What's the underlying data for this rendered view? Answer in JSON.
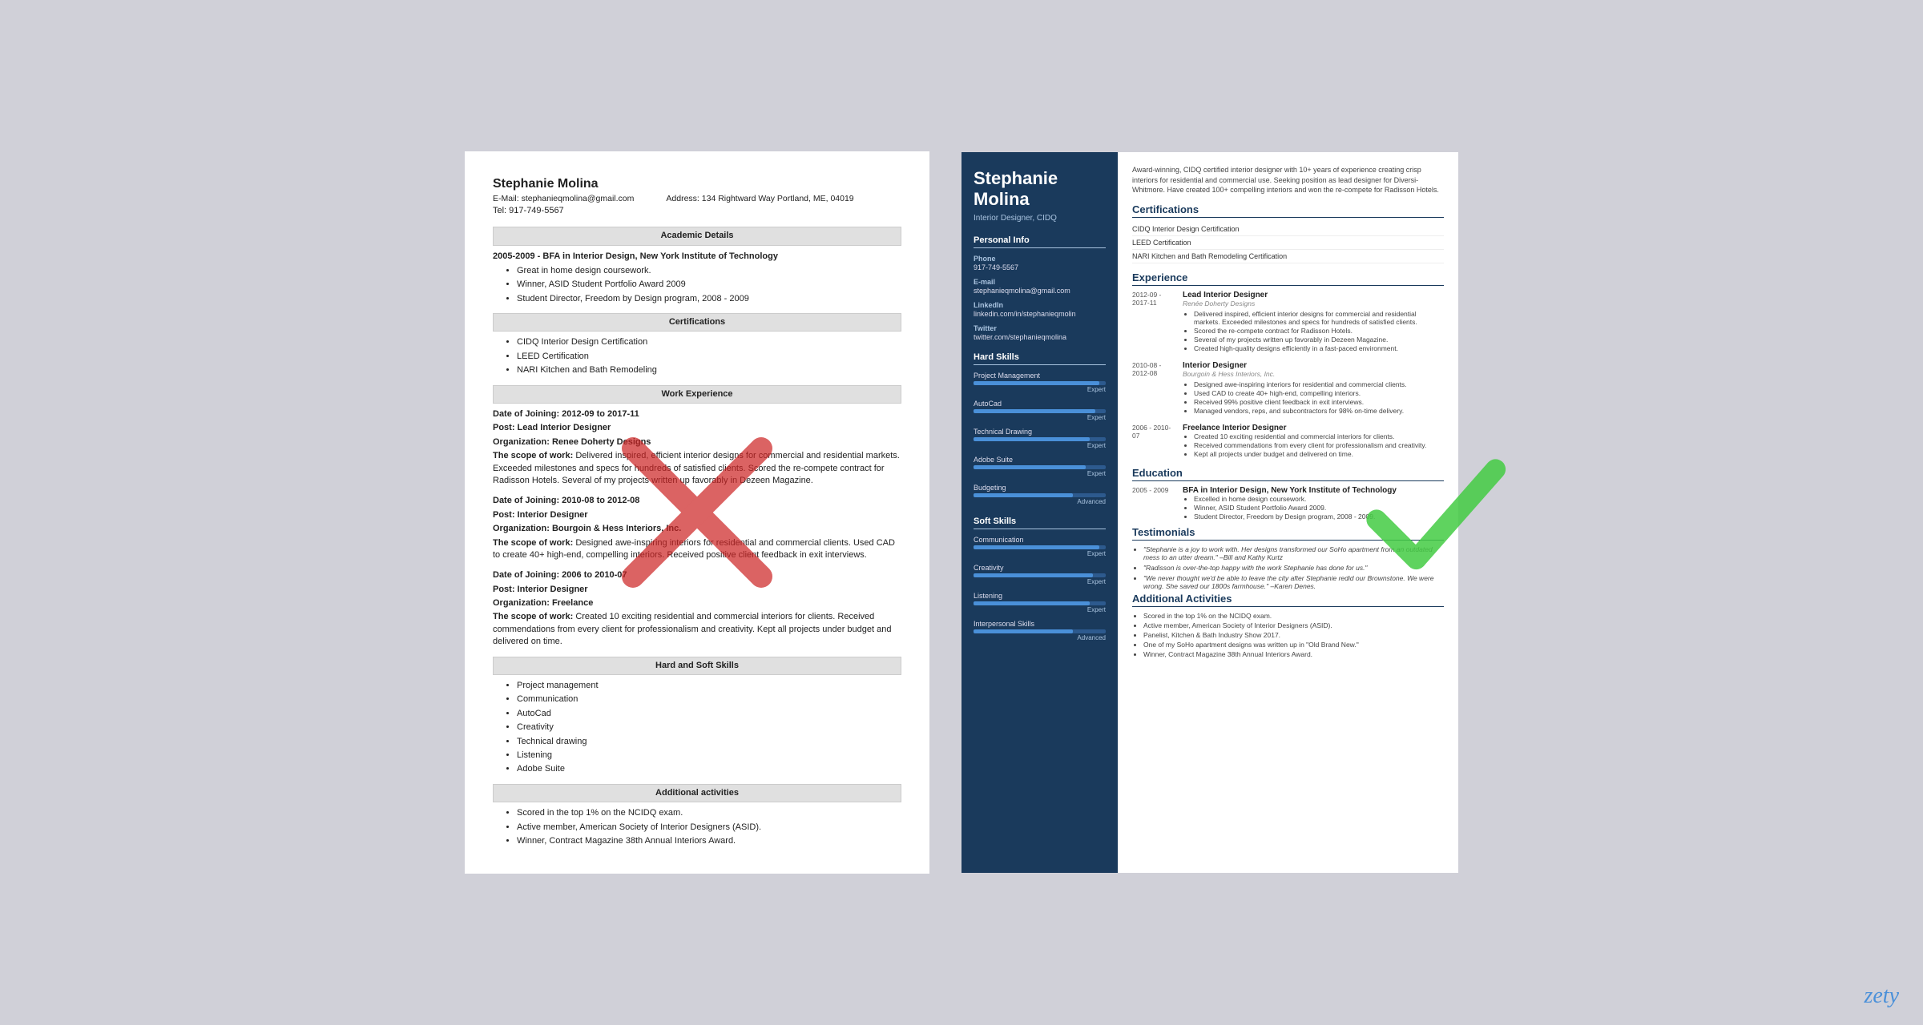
{
  "left_resume": {
    "name": "Stephanie Molina",
    "email_label": "E-Mail: stephanieqmolina@gmail.com",
    "address_label": "Address: 134 Rightward Way Portland, ME, 04019",
    "phone_label": "Tel: 917-749-5567",
    "sections": {
      "academic": {
        "header": "Academic Details",
        "entry": "2005-2009 - BFA in Interior Design, New York Institute of Technology",
        "bullets": [
          "Great in home design coursework.",
          "Winner, ASID Student Portfolio Award 2009",
          "Student Director, Freedom by Design program, 2008 - 2009"
        ]
      },
      "certifications": {
        "header": "Certifications",
        "items": [
          "CIDQ Interior Design Certification",
          "LEED Certification",
          "NARI Kitchen and Bath Remodeling"
        ]
      },
      "experience": {
        "header": "Work Experience",
        "jobs": [
          {
            "dates": "Date of Joining: 2012-09 to 2017-11",
            "post": "Post: Lead Interior Designer",
            "org": "Organization: Renee Doherty Designs",
            "scope_label": "The scope of work:",
            "scope": "Delivered inspired, efficient interior designs for commercial and residential markets. Exceeded milestones and specs for hundreds of satisfied clients. Scored the re-compete contract for Radisson Hotels. Several of my projects written up favorably in Dezeen Magazine."
          },
          {
            "dates": "Date of Joining: 2010-08 to 2012-08",
            "post": "Post: Interior Designer",
            "org": "Organization: Bourgoin & Hess Interiors, Inc.",
            "scope_label": "The scope of work:",
            "scope": "Designed awe-inspiring interiors for residential and commercial clients. Used CAD to create 40+ high-end, compelling interiors. Received positive client feedback in exit interviews."
          },
          {
            "dates": "Date of Joining: 2006 to 2010-07",
            "post": "Post: Interior Designer",
            "org": "Organization: Freelance",
            "scope_label": "The scope of work:",
            "scope": "Created 10 exciting residential and commercial interiors for clients. Received commendations from every client for professionalism and creativity. Kept all projects under budget and delivered on time."
          }
        ]
      },
      "skills": {
        "header": "Hard and Soft Skills",
        "items": [
          "Project management",
          "Communication",
          "AutoCad",
          "Creativity",
          "Technical drawing",
          "Listening",
          "Adobe Suite"
        ]
      },
      "activities": {
        "header": "Additional activities",
        "items": [
          "Scored in the top 1% on the NCIDQ exam.",
          "Active member, American Society of Interior Designers (ASID).",
          "Winner, Contract Magazine 38th Annual Interiors Award."
        ]
      }
    }
  },
  "right_resume": {
    "name": "Stephanie Molina",
    "title": "Interior Designer, CIDQ",
    "summary": "Award-winning, CIDQ certified interior designer with 10+ years of experience creating crisp interiors for residential and commercial use. Seeking position as lead designer for Diversi-Whitmore. Have created 100+ compelling interiors and won the re-compete for Radisson Hotels.",
    "sidebar": {
      "personal_info_label": "Personal Info",
      "phone_label": "Phone",
      "phone": "917-749-5567",
      "email_label": "E-mail",
      "email": "stephanieqmolina@gmail.com",
      "linkedin_label": "LinkedIn",
      "linkedin": "linkedin.com/in/stephanieqmolin",
      "twitter_label": "Twitter",
      "twitter": "twitter.com/stephanieqmolina",
      "hard_skills_label": "Hard Skills",
      "hard_skills": [
        {
          "name": "Project Management",
          "level": "Expert",
          "pct": 95
        },
        {
          "name": "AutoCad",
          "level": "Expert",
          "pct": 92
        },
        {
          "name": "Technical Drawing",
          "level": "Expert",
          "pct": 88
        },
        {
          "name": "Adobe Suite",
          "level": "Expert",
          "pct": 85
        },
        {
          "name": "Budgeting",
          "level": "Advanced",
          "pct": 75
        }
      ],
      "soft_skills_label": "Soft Skills",
      "soft_skills": [
        {
          "name": "Communication",
          "level": "Expert",
          "pct": 95
        },
        {
          "name": "Creativity",
          "level": "Expert",
          "pct": 90
        },
        {
          "name": "Listening",
          "level": "Expert",
          "pct": 88
        },
        {
          "name": "Interpersonal Skills",
          "level": "Advanced",
          "pct": 75
        }
      ]
    },
    "certifications_label": "Certifications",
    "certifications": [
      "CIDQ Interior Design Certification",
      "LEED Certification",
      "NARI Kitchen and Bath Remodeling Certification"
    ],
    "experience_label": "Experience",
    "experience": [
      {
        "dates": "2012-09 - 2017-11",
        "title": "Lead Interior Designer",
        "company": "Renée Doherty Designs",
        "bullets": [
          "Delivered inspired, efficient interior designs for commercial and residential markets. Exceeded milestones and specs for hundreds of satisfied clients.",
          "Scored the re-compete contract for Radisson Hotels.",
          "Several of my projects written up favorably in Dezeen Magazine.",
          "Created high-quality designs efficiently in a fast-paced environment."
        ]
      },
      {
        "dates": "2010-08 - 2012-08",
        "title": "Interior Designer",
        "company": "Bourgoin & Hess Interiors, Inc.",
        "bullets": [
          "Designed awe-inspiring interiors for residential and commercial clients.",
          "Used CAD to create 40+ high-end, compelling interiors.",
          "Received 99% positive client feedback in exit interviews.",
          "Managed vendors, reps, and subcontractors for 98% on-time delivery."
        ]
      },
      {
        "dates": "2006 - 2010-07",
        "title": "Freelance Interior Designer",
        "company": "",
        "bullets": [
          "Created 10 exciting residential and commercial interiors for clients.",
          "Received commendations from every client for professionalism and creativity.",
          "Kept all projects under budget and delivered on time."
        ]
      }
    ],
    "education_label": "Education",
    "education": [
      {
        "dates": "2005 - 2009",
        "degree": "BFA in Interior Design, New York Institute of Technology",
        "bullets": [
          "Excelled in home design coursework.",
          "Winner, ASID Student Portfolio Award 2009.",
          "Student Director, Freedom by Design program, 2008 - 2009."
        ]
      }
    ],
    "testimonials_label": "Testimonials",
    "testimonials": [
      "\"Stephanie is a joy to work with. Her designs transformed our SoHo apartment from an outdated mess to an utter dream.\" –Bill and Kathy Kurtz",
      "\"Radisson is over-the-top happy with the work Stephanie has done for us.\"",
      "\"We never thought we'd be able to leave the city after Stephanie redid our Brownstone. We were wrong. She saved our 1800s farmhouse.\" –Karen Denes."
    ],
    "activities_label": "Additional Activities",
    "activities": [
      "Scored in the top 1% on the NCIDQ exam.",
      "Active member, American Society of Interior Designers (ASID).",
      "Panelist, Kitchen & Bath Industry Show 2017.",
      "One of my SoHo apartment designs was written up in \"Old Brand New.\"",
      "Winner, Contract Magazine 38th Annual Interiors Award."
    ]
  },
  "zety": "zety"
}
